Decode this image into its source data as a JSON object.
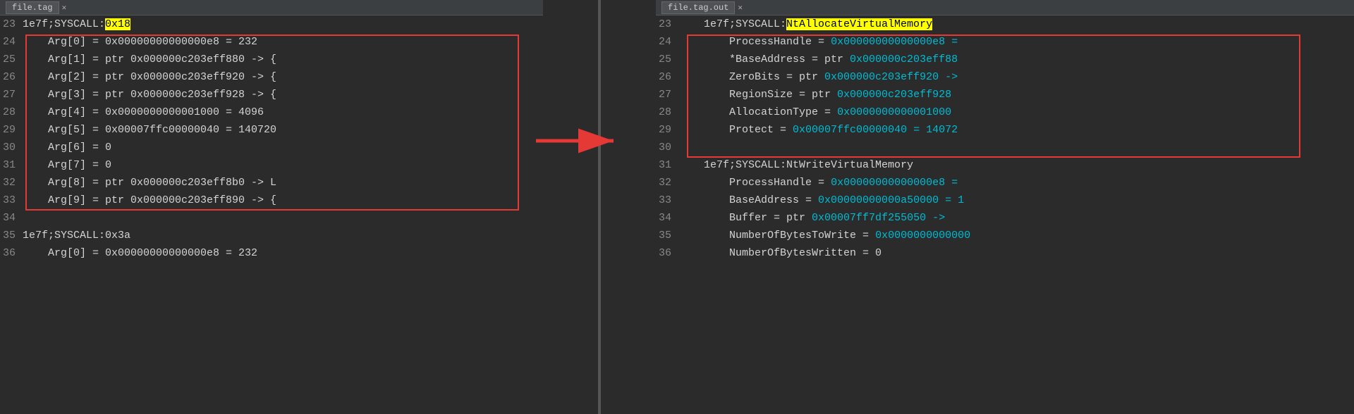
{
  "left_panel": {
    "tab": "file.tag",
    "lines": [
      {
        "num": "23",
        "content": [
          {
            "text": "1e7f;SYSCALL:",
            "class": "color-white"
          },
          {
            "text": "0x18",
            "class": "highlight-yellow"
          }
        ]
      },
      {
        "num": "24",
        "content": [
          {
            "text": "    Arg[0]",
            "class": "color-white"
          },
          {
            "text": " = 0x00000000000000e8 = 232",
            "class": "color-white"
          }
        ]
      },
      {
        "num": "25",
        "content": [
          {
            "text": "    Arg[1]",
            "class": "color-white"
          },
          {
            "text": " = ptr 0x000000c203eff880 -> {",
            "class": "color-white"
          }
        ]
      },
      {
        "num": "26",
        "content": [
          {
            "text": "    Arg[2]",
            "class": "color-white"
          },
          {
            "text": " = ptr 0x000000c203eff920 -> {",
            "class": "color-white"
          }
        ]
      },
      {
        "num": "27",
        "content": [
          {
            "text": "    Arg[3]",
            "class": "color-white"
          },
          {
            "text": " = ptr 0x000000c203eff928 -> {",
            "class": "color-white"
          }
        ]
      },
      {
        "num": "28",
        "content": [
          {
            "text": "    Arg[4]",
            "class": "color-white"
          },
          {
            "text": " = 0x0000000000001000 = 4096",
            "class": "color-white"
          }
        ]
      },
      {
        "num": "29",
        "content": [
          {
            "text": "    Arg[5]",
            "class": "color-white"
          },
          {
            "text": " = 0x00007ffc00000040 = 140720",
            "class": "color-white"
          }
        ]
      },
      {
        "num": "30",
        "content": [
          {
            "text": "    Arg[6]",
            "class": "color-white"
          },
          {
            "text": " = 0",
            "class": "color-white"
          }
        ]
      },
      {
        "num": "31",
        "content": [
          {
            "text": "    Arg[7]",
            "class": "color-white"
          },
          {
            "text": " = 0",
            "class": "color-white"
          }
        ]
      },
      {
        "num": "32",
        "content": [
          {
            "text": "    Arg[8]",
            "class": "color-white"
          },
          {
            "text": " = ptr 0x000000c203eff8b0 -> L",
            "class": "color-white"
          }
        ]
      },
      {
        "num": "33",
        "content": [
          {
            "text": "    Arg[9]",
            "class": "color-white"
          },
          {
            "text": " = ptr 0x000000c203eff890 -> {",
            "class": "color-white"
          }
        ]
      },
      {
        "num": "34",
        "content": [
          {
            "text": "",
            "class": "color-white"
          }
        ]
      },
      {
        "num": "35",
        "content": [
          {
            "text": "1e7f;SYSCALL:",
            "class": "color-white"
          },
          {
            "text": "0x3a",
            "class": "color-white"
          }
        ]
      },
      {
        "num": "36",
        "content": [
          {
            "text": "    Arg[0]",
            "class": "color-white"
          },
          {
            "text": " = 0x00000000000000e8 = 232",
            "class": "color-white"
          }
        ]
      }
    ]
  },
  "right_panel": {
    "tab": "file.tag.out",
    "lines": [
      {
        "num": "23",
        "content": [
          {
            "text": "    1e7f;SYSCALL:",
            "class": "color-white"
          },
          {
            "text": "NtAllocateVirtualMemory",
            "class": "highlight-yellow"
          }
        ]
      },
      {
        "num": "24",
        "content": [
          {
            "text": "        ProcessHandle",
            "class": "color-white"
          },
          {
            "text": " = ",
            "class": "color-white"
          },
          {
            "text": "0x00000000000000e8 =",
            "class": "color-cyan"
          }
        ]
      },
      {
        "num": "25",
        "content": [
          {
            "text": "        *BaseAddress",
            "class": "color-white"
          },
          {
            "text": " = ptr ",
            "class": "color-white"
          },
          {
            "text": "0x000000c203eff88",
            "class": "color-cyan"
          }
        ]
      },
      {
        "num": "26",
        "content": [
          {
            "text": "        ZeroBits",
            "class": "color-white"
          },
          {
            "text": " = ptr ",
            "class": "color-white"
          },
          {
            "text": "0x000000c203eff920 ->",
            "class": "color-cyan"
          }
        ]
      },
      {
        "num": "27",
        "content": [
          {
            "text": "        RegionSize",
            "class": "color-white"
          },
          {
            "text": " = ptr ",
            "class": "color-white"
          },
          {
            "text": "0x000000c203eff928",
            "class": "color-cyan"
          }
        ]
      },
      {
        "num": "28",
        "content": [
          {
            "text": "        AllocationType",
            "class": "color-white"
          },
          {
            "text": " = ",
            "class": "color-white"
          },
          {
            "text": "0x0000000000001000",
            "class": "color-cyan"
          }
        ]
      },
      {
        "num": "29",
        "content": [
          {
            "text": "        Protect",
            "class": "color-white"
          },
          {
            "text": " = ",
            "class": "color-white"
          },
          {
            "text": "0x00007ffc00000040 = 14072",
            "class": "color-cyan"
          }
        ]
      },
      {
        "num": "30",
        "content": [
          {
            "text": "",
            "class": "color-white"
          }
        ]
      },
      {
        "num": "31",
        "content": [
          {
            "text": "    1e7f;SYSCALL:",
            "class": "color-white"
          },
          {
            "text": "NtWriteVirtualMemory",
            "class": "color-white"
          }
        ]
      },
      {
        "num": "32",
        "content": [
          {
            "text": "        ProcessHandle",
            "class": "color-white"
          },
          {
            "text": " = ",
            "class": "color-white"
          },
          {
            "text": "0x00000000000000e8 =",
            "class": "color-cyan"
          }
        ]
      },
      {
        "num": "33",
        "content": [
          {
            "text": "        BaseAddress",
            "class": "color-white"
          },
          {
            "text": " = ",
            "class": "color-white"
          },
          {
            "text": "0x00000000000a50000 = 1",
            "class": "color-cyan"
          }
        ]
      },
      {
        "num": "34",
        "content": [
          {
            "text": "        Buffer",
            "class": "color-white"
          },
          {
            "text": " = ptr ",
            "class": "color-white"
          },
          {
            "text": "0x00007ff7df255050 ->",
            "class": "color-cyan"
          }
        ]
      },
      {
        "num": "35",
        "content": [
          {
            "text": "        NumberOfBytesToWrite",
            "class": "color-white"
          },
          {
            "text": " = ",
            "class": "color-white"
          },
          {
            "text": "0x0000000000000",
            "class": "color-cyan"
          }
        ]
      },
      {
        "num": "36",
        "content": [
          {
            "text": "        NumberOfBytesWritten",
            "class": "color-white"
          },
          {
            "text": " = 0",
            "class": "color-white"
          }
        ]
      }
    ]
  }
}
